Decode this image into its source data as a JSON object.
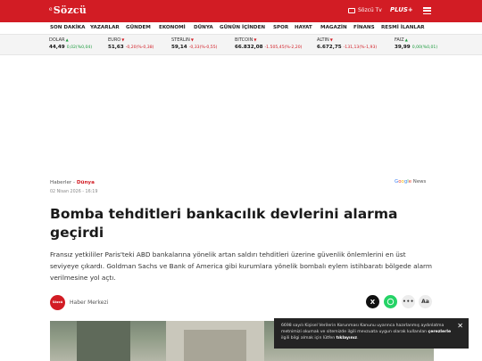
{
  "header": {
    "logo_prefix": "e",
    "logo": "Sözcü",
    "tv_label": "Sözcü Tv",
    "plus_label": "PLUS+"
  },
  "nav": [
    "SON DAKİKA",
    "YAZARLAR",
    "GÜNDEM",
    "EKONOMİ",
    "DÜNYA",
    "GÜNÜN İÇİNDEN",
    "SPOR",
    "HAYAT",
    "MAGAZİN",
    "FİNANS",
    "RESMİ İLANLAR"
  ],
  "ticker": [
    {
      "name": "DOLAR",
      "value": "44,49",
      "change": "0,02(%0,04)",
      "direction": "up"
    },
    {
      "name": "EURO",
      "value": "51,63",
      "change": "-0,20(%-0,38)",
      "direction": "down"
    },
    {
      "name": "STERLIN",
      "value": "59,14",
      "change": "-0,33(%-0,55)",
      "direction": "down"
    },
    {
      "name": "BITCOIN",
      "value": "66.832,08",
      "change": "-1.505,45(%-2,20)",
      "direction": "down"
    },
    {
      "name": "ALTIN",
      "value": "6.672,75",
      "change": "-131,13(%-1,93)",
      "direction": "down"
    },
    {
      "name": "FAIZ",
      "value": "39,99",
      "change": "0,00(%0,01)",
      "direction": "up"
    }
  ],
  "article": {
    "breadcrumb_parent": "Haberler",
    "breadcrumb_sep": " - ",
    "breadcrumb_category": "Dünya",
    "date": "02 Nisan 2026 - 16:19",
    "google_news": "Google News",
    "headline": "Bomba tehditleri bankacılık devlerini alarma geçirdi",
    "summary": "Fransız yetkililer Paris'teki ABD bankalarına yönelik artan saldırı tehditleri üzerine güvenlik önlemlerini en üst seviyeye çıkardı. Goldman Sachs ve Bank of America gibi kurumlara yönelik bombalı eylem istihbaratı bölgede alarm verilmesine yol açtı.",
    "author_avatar_text": "Sözcü",
    "author": "Haber Merkezi",
    "share_x": "X",
    "share_more": "•••",
    "share_font": "Aa"
  },
  "cookie": {
    "text_before": "6698 sayılı Kişisel Verilerin Korunması Kanunu uyarınca hazırlanmış aydınlatma metnimizi okumak ve sitemizde ilgili mevzuata uygun olarak kullanılan ",
    "bold1": "çerezlerle",
    "text_middle": " ilgili bilgi almak için lütfen ",
    "bold2": "tıklayınız",
    "text_after": "."
  },
  "colors": {
    "brand": "#d21c24",
    "up": "#1a9a3c",
    "down": "#d21c24"
  },
  "icons": [
    "tv-icon",
    "menu-icon",
    "google-news-icon",
    "x-share-icon",
    "whatsapp-icon",
    "more-icon",
    "font-size-icon",
    "close-icon"
  ]
}
